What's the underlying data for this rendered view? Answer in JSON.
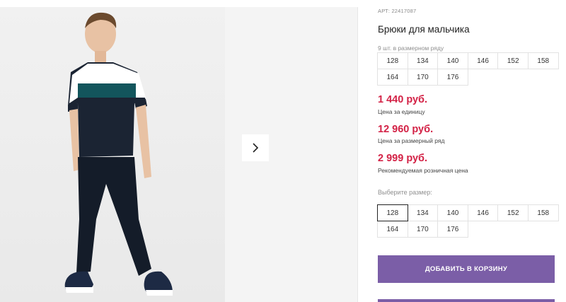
{
  "product": {
    "article_label": "АРТ:",
    "article": "22417087",
    "title": "Брюки для мальчика",
    "pack_note": "9 шт. в размерном ряду",
    "pack_sizes": [
      "128",
      "134",
      "140",
      "146",
      "152",
      "158",
      "164",
      "170",
      "176"
    ],
    "price_unit": "1 440 руб.",
    "price_unit_note": "Цена за единицу",
    "price_pack": "12 960 руб.",
    "price_pack_note": "Цена за размерный ряд",
    "price_retail": "2 999 руб.",
    "price_retail_note": "Рекомендуемая розничная цена",
    "choose_size": "Выберите размер:",
    "select_sizes": [
      "128",
      "134",
      "140",
      "146",
      "152",
      "158",
      "164",
      "170",
      "176"
    ],
    "selected_size": "128",
    "add_to_cart": "ДОБАВИТЬ В КОРЗИНУ"
  },
  "gallery": {
    "next_icon": "chevron-right-icon"
  },
  "colors": {
    "price": "#d32246",
    "button": "#7b5ea7"
  }
}
